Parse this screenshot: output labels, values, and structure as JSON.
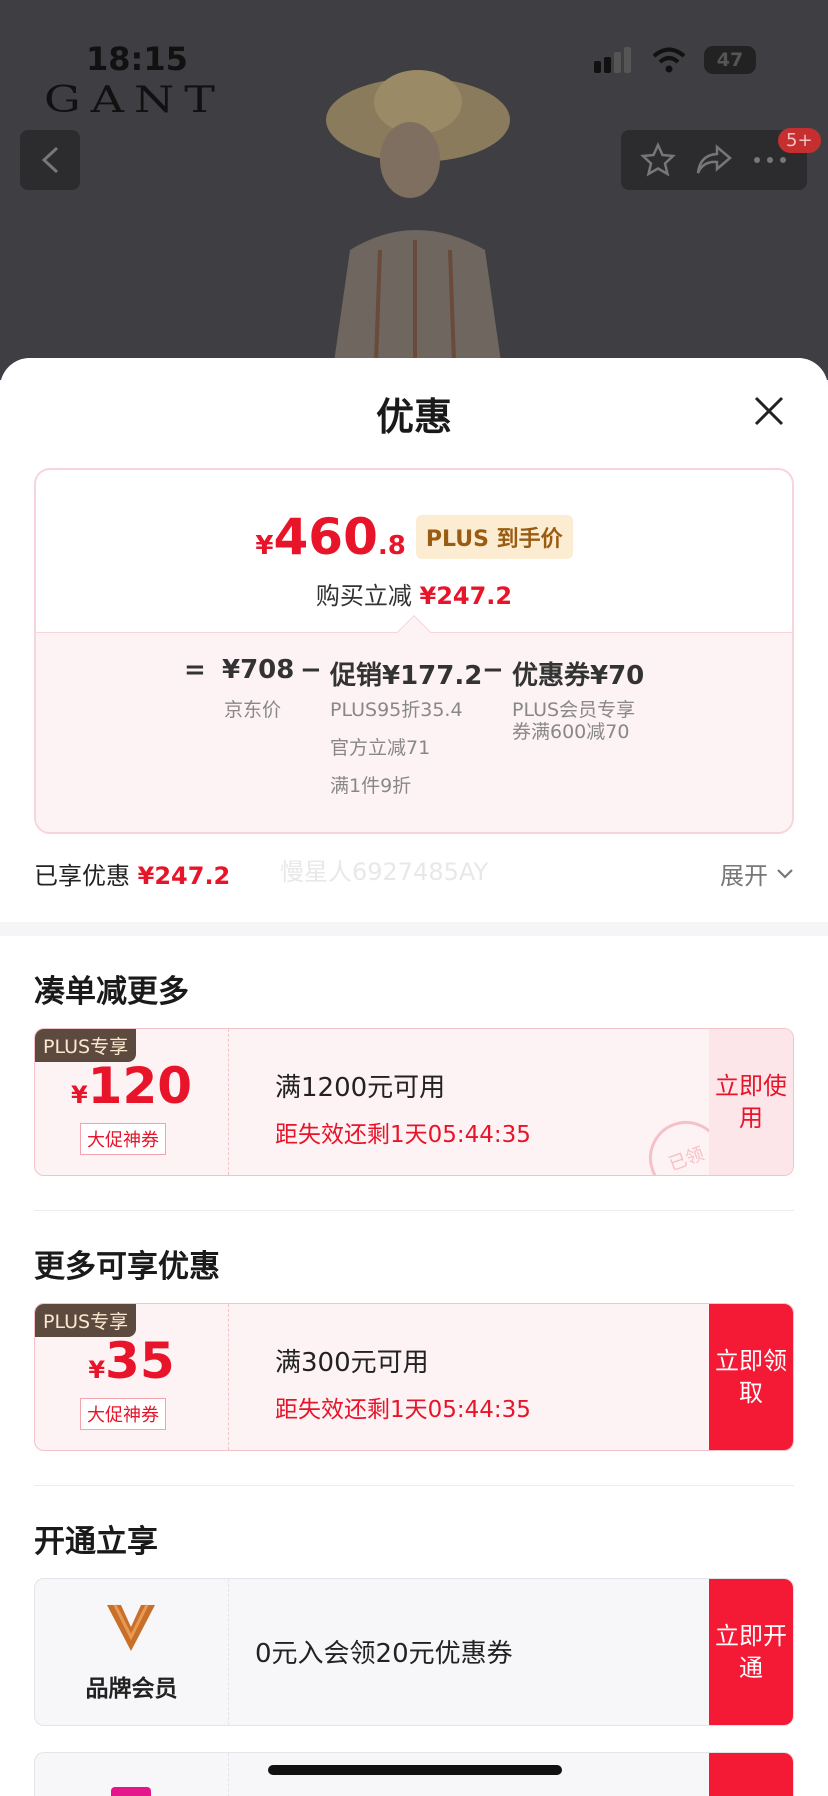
{
  "status_bar": {
    "time": "18:15",
    "battery": "47"
  },
  "product": {
    "brand": "GANT",
    "notification_count": "5+"
  },
  "sheet": {
    "title": "优惠"
  },
  "price_card": {
    "currency": "¥",
    "price_int": "460",
    "price_dec": ".8",
    "plus_tag": "PLUS 到手价",
    "discount_label": "购买立减",
    "discount_amount": "¥247.2",
    "formula": {
      "equals": "=",
      "minus": "−",
      "jd_price": "¥708",
      "jd_price_label": "京东价",
      "promo": "促销¥177.2",
      "promo_notes": [
        "PLUS95折35.4",
        "官方立减71",
        "满1件9折"
      ],
      "coupon": "优惠券¥70",
      "coupon_note": "PLUS会员专享券满600减70"
    }
  },
  "enjoyed": {
    "label": "已享优惠",
    "amount": "¥247.2",
    "watermark": "慢星人6927485AY",
    "expand_label": "展开"
  },
  "sections": [
    {
      "title": "凑单减更多",
      "coupon": {
        "plus_label": "PLUS专享",
        "currency": "¥",
        "amount": "120",
        "type": "大促神券",
        "condition": "满1200元可用",
        "expiry": "距失效还剩1天05:44:35",
        "action": "立即使用",
        "stamp": "已领"
      }
    },
    {
      "title": "更多可享优惠",
      "coupon": {
        "plus_label": "PLUS专享",
        "currency": "¥",
        "amount": "35",
        "type": "大促神券",
        "condition": "满300元可用",
        "expiry": "距失效还剩1天05:44:35",
        "action": "立即领取"
      }
    },
    {
      "title": "开通立享",
      "member": {
        "label": "品牌会员",
        "text": "0元入会领20元优惠券",
        "action": "立即开通"
      }
    }
  ],
  "colors": {
    "accent_red": "#e8142a",
    "button_red": "#f41a36",
    "plus_brown": "#5c4a3e"
  }
}
